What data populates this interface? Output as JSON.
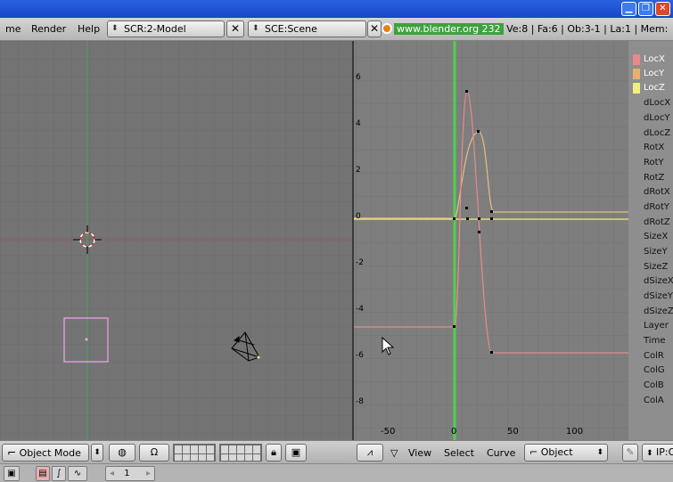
{
  "menubar": {
    "items": [
      "me",
      "Render",
      "Help"
    ],
    "screen": "SCR:2-Model",
    "scene": "SCE:Scene",
    "website": "www.blender.org 232",
    "stats": "Ve:8 | Fa:6 | Ob:3-1 | La:1 | Mem:"
  },
  "ipo": {
    "y_ticks": [
      "6",
      "4",
      "2",
      "0",
      "-2",
      "-4",
      "-6",
      "-8"
    ],
    "x_ticks": [
      "-50",
      "0",
      "50",
      "100"
    ],
    "colors": {
      "locx": "#e88a8a",
      "locy": "#e8c080",
      "locz": "#f0ee80",
      "current_frame": "#4ed24e",
      "background": "#7e7e7e"
    }
  },
  "channels": [
    {
      "label": "LocX",
      "color": "#e88a8a",
      "active": true
    },
    {
      "label": "LocY",
      "color": "#e8b070",
      "active": true
    },
    {
      "label": "LocZ",
      "color": "#f0ee80",
      "active": true
    },
    {
      "label": "dLocX",
      "active": false
    },
    {
      "label": "dLocY",
      "active": false
    },
    {
      "label": "dLocZ",
      "active": false
    },
    {
      "label": "RotX",
      "active": false
    },
    {
      "label": "RotY",
      "active": false
    },
    {
      "label": "RotZ",
      "active": false
    },
    {
      "label": "dRotX",
      "active": false
    },
    {
      "label": "dRotY",
      "active": false
    },
    {
      "label": "dRotZ",
      "active": false
    },
    {
      "label": "SizeX",
      "active": false
    },
    {
      "label": "SizeY",
      "active": false
    },
    {
      "label": "SizeZ",
      "active": false
    },
    {
      "label": "dSizeX",
      "active": false
    },
    {
      "label": "dSizeY",
      "active": false
    },
    {
      "label": "dSizeZ",
      "active": false
    },
    {
      "label": "Layer",
      "active": false
    },
    {
      "label": "Time",
      "active": false
    },
    {
      "label": "ColR",
      "active": false
    },
    {
      "label": "ColG",
      "active": false
    },
    {
      "label": "ColB",
      "active": false
    },
    {
      "label": "ColA",
      "active": false
    }
  ],
  "bottombar": {
    "mode": "Object Mode",
    "ipo_menus": [
      "View",
      "Select",
      "Curve"
    ],
    "ipo_type": "Object",
    "ipo_block": "IP:O"
  },
  "timeline": {
    "frame": "1"
  }
}
